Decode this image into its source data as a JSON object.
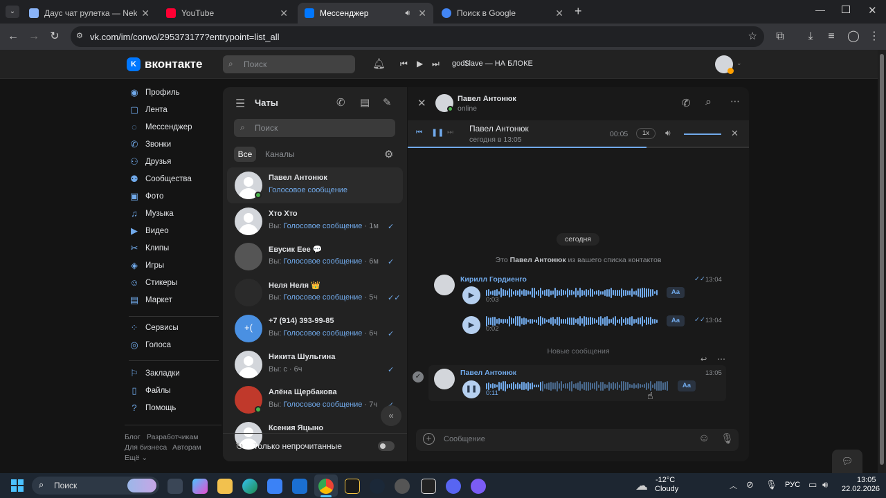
{
  "browser": {
    "tabs": [
      {
        "title": "Даус чат рулетка — Nekto",
        "color": "#8ab4f8"
      },
      {
        "title": "YouTube",
        "color": "#ff0033"
      },
      {
        "title": "Мессенджер",
        "color": "#0077ff"
      },
      {
        "title": "Поиск в Google",
        "color": "#4285f4"
      }
    ],
    "url": "vk.com/im/convo/295373177?entrypoint=list_all"
  },
  "vk": {
    "logo": "вконтакте",
    "search_placeholder": "Поиск",
    "now_playing": "god$lave — НА БЛОКЕ"
  },
  "menu": {
    "items": [
      {
        "label": "Профиль",
        "icon": "profile-icon"
      },
      {
        "label": "Лента",
        "icon": "feed-icon"
      },
      {
        "label": "Мессенджер",
        "icon": "messenger-icon"
      },
      {
        "label": "Звонки",
        "icon": "phone-icon"
      },
      {
        "label": "Друзья",
        "icon": "friends-icon"
      },
      {
        "label": "Сообщества",
        "icon": "communities-icon"
      },
      {
        "label": "Фото",
        "icon": "photo-icon"
      },
      {
        "label": "Музыка",
        "icon": "music-icon"
      },
      {
        "label": "Видео",
        "icon": "video-icon"
      },
      {
        "label": "Клипы",
        "icon": "clips-icon"
      },
      {
        "label": "Игры",
        "icon": "games-icon"
      },
      {
        "label": "Стикеры",
        "icon": "stickers-icon"
      },
      {
        "label": "Маркет",
        "icon": "market-icon"
      },
      {
        "label": "Сервисы",
        "icon": "services-icon"
      },
      {
        "label": "Голоса",
        "icon": "votes-icon"
      },
      {
        "label": "Закладки",
        "icon": "bookmarks-icon"
      },
      {
        "label": "Файлы",
        "icon": "files-icon"
      },
      {
        "label": "Помощь",
        "icon": "help-icon"
      }
    ],
    "footer": {
      "blog": "Блог",
      "devs": "Разработчикам",
      "business": "Для бизнеса",
      "authors": "Авторам",
      "more": "Ещё"
    }
  },
  "chats": {
    "title": "Чаты",
    "search_placeholder": "Поиск",
    "filter_all": "Все",
    "filter_channels": "Каналы",
    "unread_only": "Только непрочитанные",
    "list": [
      {
        "name": "Павел Антонюк",
        "preview_prefix": "",
        "preview": "Голосовое сообщение",
        "time": "",
        "online": true
      },
      {
        "name": "Хто Хто",
        "preview_prefix": "Вы: ",
        "preview": "Голосовое сообщение",
        "time": "· 1м",
        "online": false
      },
      {
        "name": "Евусик Еее 💬",
        "preview_prefix": "Вы: ",
        "preview": "Голосовое сообщение",
        "time": "· 6м",
        "online": false
      },
      {
        "name": "Неля Неля 👑",
        "preview_prefix": "Вы: ",
        "preview": "Голосовое сообщение",
        "time": "· 5ч",
        "online": false
      },
      {
        "name": "+7 (914) 393-99-85",
        "preview_prefix": "Вы: ",
        "preview": "Голосовое сообщение",
        "time": "· 6ч",
        "online": false
      },
      {
        "name": "Никита Шульгина",
        "preview_prefix": "Вы: с",
        "preview": "",
        "time": "· 6ч",
        "online": false
      },
      {
        "name": "Алёна Щербакова",
        "preview_prefix": "Вы: ",
        "preview": "Голосовое сообщение",
        "time": "· 7ч",
        "online": true
      },
      {
        "name": "Ксения Яцыно",
        "preview_prefix": "",
        "preview": "",
        "time": "",
        "online": false
      }
    ]
  },
  "conversation": {
    "contact_name": "Павел Антонюк",
    "status": "online",
    "player": {
      "title": "Павел Антонюк",
      "subtitle": "сегодня в 13:05",
      "elapsed": "00:05",
      "speed": "1x",
      "progress": 0.7
    },
    "date_divider": "сегодня",
    "system_msg_prefix": "Это ",
    "system_msg_name": "Павел Антонюк",
    "system_msg_suffix": " из вашего списка контактов",
    "new_messages": "Новые сообщения",
    "messages": [
      {
        "author": "Кирилл Гордиенго",
        "duration": "0:03",
        "time": "13:04",
        "aa": "Aa"
      },
      {
        "author": "",
        "duration": "0:02",
        "time": "13:04",
        "aa": "Aa"
      },
      {
        "author": "Павел Антонюк",
        "duration": "0:11",
        "time": "13:05",
        "aa": "Aa"
      }
    ],
    "input_placeholder": "Сообщение"
  },
  "taskbar": {
    "search": "Поиск",
    "weather_temp": "-12°C",
    "weather_desc": "Cloudy",
    "lang": "РУС",
    "time": "13:05",
    "date": "22.02.2026"
  }
}
